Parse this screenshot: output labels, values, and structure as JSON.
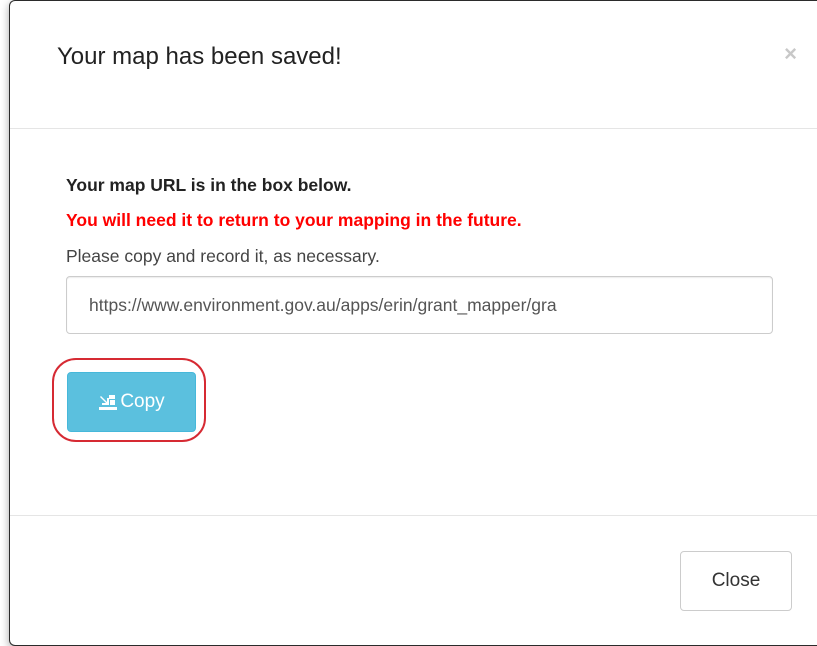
{
  "dialog": {
    "title": "Your map has been saved!",
    "close_glyph": "×"
  },
  "body": {
    "line1": "Your map URL is in the box below.",
    "line2": "You will need it to return to your mapping in the future.",
    "line3": "Please copy and record it, as necessary.",
    "url_value": "https://www.environment.gov.au/apps/erin/grant_mapper/gra",
    "copy_label": "Copy",
    "copy_icon": "paste-icon"
  },
  "footer": {
    "close_label": "Close"
  },
  "colors": {
    "warning_text": "#ff0000",
    "copy_button_bg": "#5bc0de",
    "highlight_ring": "#d62a33"
  }
}
